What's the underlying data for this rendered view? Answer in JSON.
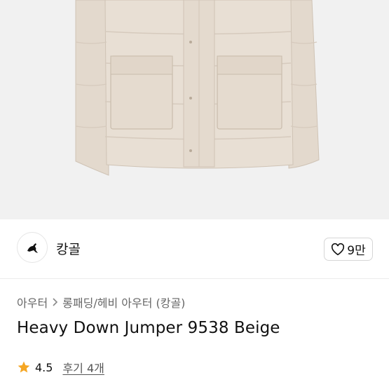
{
  "colors": {
    "accent_star": "#f5a623",
    "jacket": "#e6ddd2",
    "background_image": "#f1f1f1"
  },
  "brand": {
    "name": "캉골",
    "logo_icon": "kangaroo-logo-icon"
  },
  "like": {
    "icon": "heart-outline-icon",
    "count": "9만"
  },
  "breadcrumb": {
    "items": [
      "아우터",
      "롱패딩/헤비 아우터 (캉골)"
    ],
    "separator_icon": "chevron-right-icon"
  },
  "product": {
    "title": "Heavy Down Jumper 9538 Beige"
  },
  "rating": {
    "icon": "star-icon",
    "value": "4.5",
    "review_link": "후기 4개"
  }
}
